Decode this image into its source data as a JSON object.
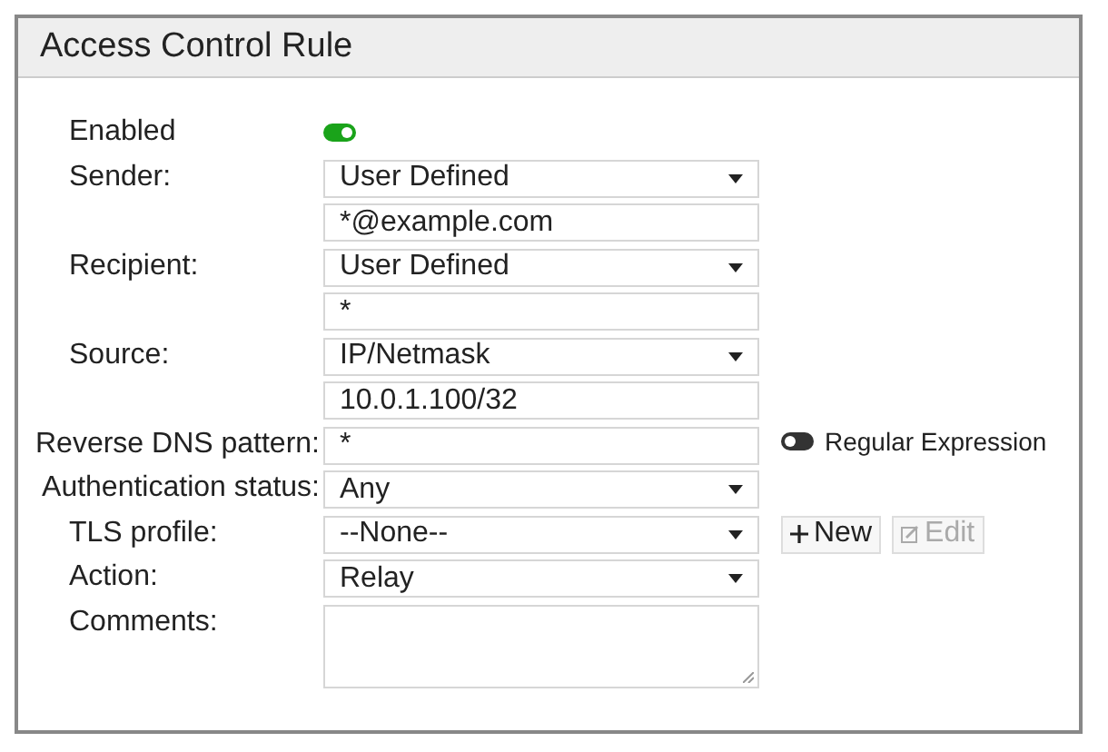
{
  "title": "Access Control Rule",
  "rows": [
    {
      "label": "Enabled",
      "kind": "toggle",
      "on": true
    },
    {
      "label": "Sender:",
      "kind": "select",
      "value": "User Defined"
    },
    {
      "kind": "text",
      "value": "*@example.com"
    },
    {
      "label": "Recipient:",
      "kind": "select",
      "value": "User Defined"
    },
    {
      "kind": "text",
      "value": "*"
    },
    {
      "label": "Source:",
      "kind": "select",
      "value": "IP/Netmask"
    },
    {
      "kind": "text",
      "value": "10.0.1.100/32"
    },
    {
      "label": "Reverse DNS pattern:",
      "kind": "text",
      "value": "*",
      "option": {
        "label": "Regular Expression",
        "on": false
      }
    },
    {
      "label": "Authentication status:",
      "kind": "select",
      "value": "Any"
    },
    {
      "label": "TLS profile:",
      "kind": "select",
      "value": "--None--",
      "buttons": [
        {
          "kind": "add",
          "label": "New",
          "disabled": false
        },
        {
          "kind": "edit",
          "label": "Edit",
          "disabled": true
        }
      ]
    },
    {
      "label": "Action:",
      "kind": "select",
      "value": "Relay"
    },
    {
      "label": "Comments:",
      "kind": "textarea"
    }
  ]
}
